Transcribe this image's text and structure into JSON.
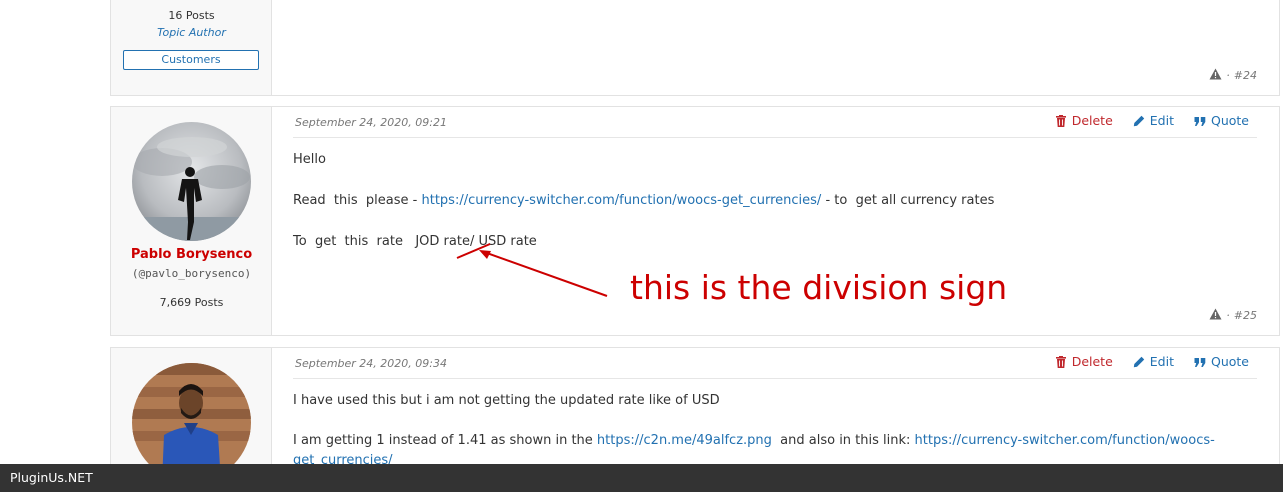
{
  "post_prev": {
    "posts_count": "16 Posts",
    "topic_author": "Topic Author",
    "role_badge": "Customers",
    "number": "#24"
  },
  "post_25": {
    "date": "September 24, 2020, 09:21",
    "author_name": "Pablo Borysenco",
    "author_handle": "(@pavlo_borysenco)",
    "posts_count": "7,669 Posts",
    "actions": {
      "delete": "Delete",
      "edit": "Edit",
      "quote": "Quote"
    },
    "line1": "Hello",
    "line2_prefix": "Read  this  please - ",
    "line2_link": "https://currency-switcher.com/function/woocs-get_currencies/",
    "line2_suffix": " - to  get all currency rates",
    "line3": "To  get  this  rate   JOD rate/ USD rate",
    "number": "#25"
  },
  "post_26": {
    "date": "September 24, 2020, 09:34",
    "actions": {
      "delete": "Delete",
      "edit": "Edit",
      "quote": "Quote"
    },
    "line1": "I have used this but i am not getting the updated rate like of USD",
    "line2_prefix": "I am getting 1 instead of 1.41 as shown in the ",
    "line2_link1": "https://c2n.me/49alfcz.png",
    "line2_mid": "  and also in this link: ",
    "line2_link2": "https://currency-switcher.com/function/woocs-get_currencies/"
  },
  "annotation": {
    "text": "this is the division sign",
    "color": "#cc0000"
  },
  "footer": {
    "label": "PluginUs.NET"
  },
  "colors": {
    "link": "#2271b1",
    "delete": "#c0282d",
    "author_name": "#cc0000",
    "bottom_bar": "#333333"
  }
}
